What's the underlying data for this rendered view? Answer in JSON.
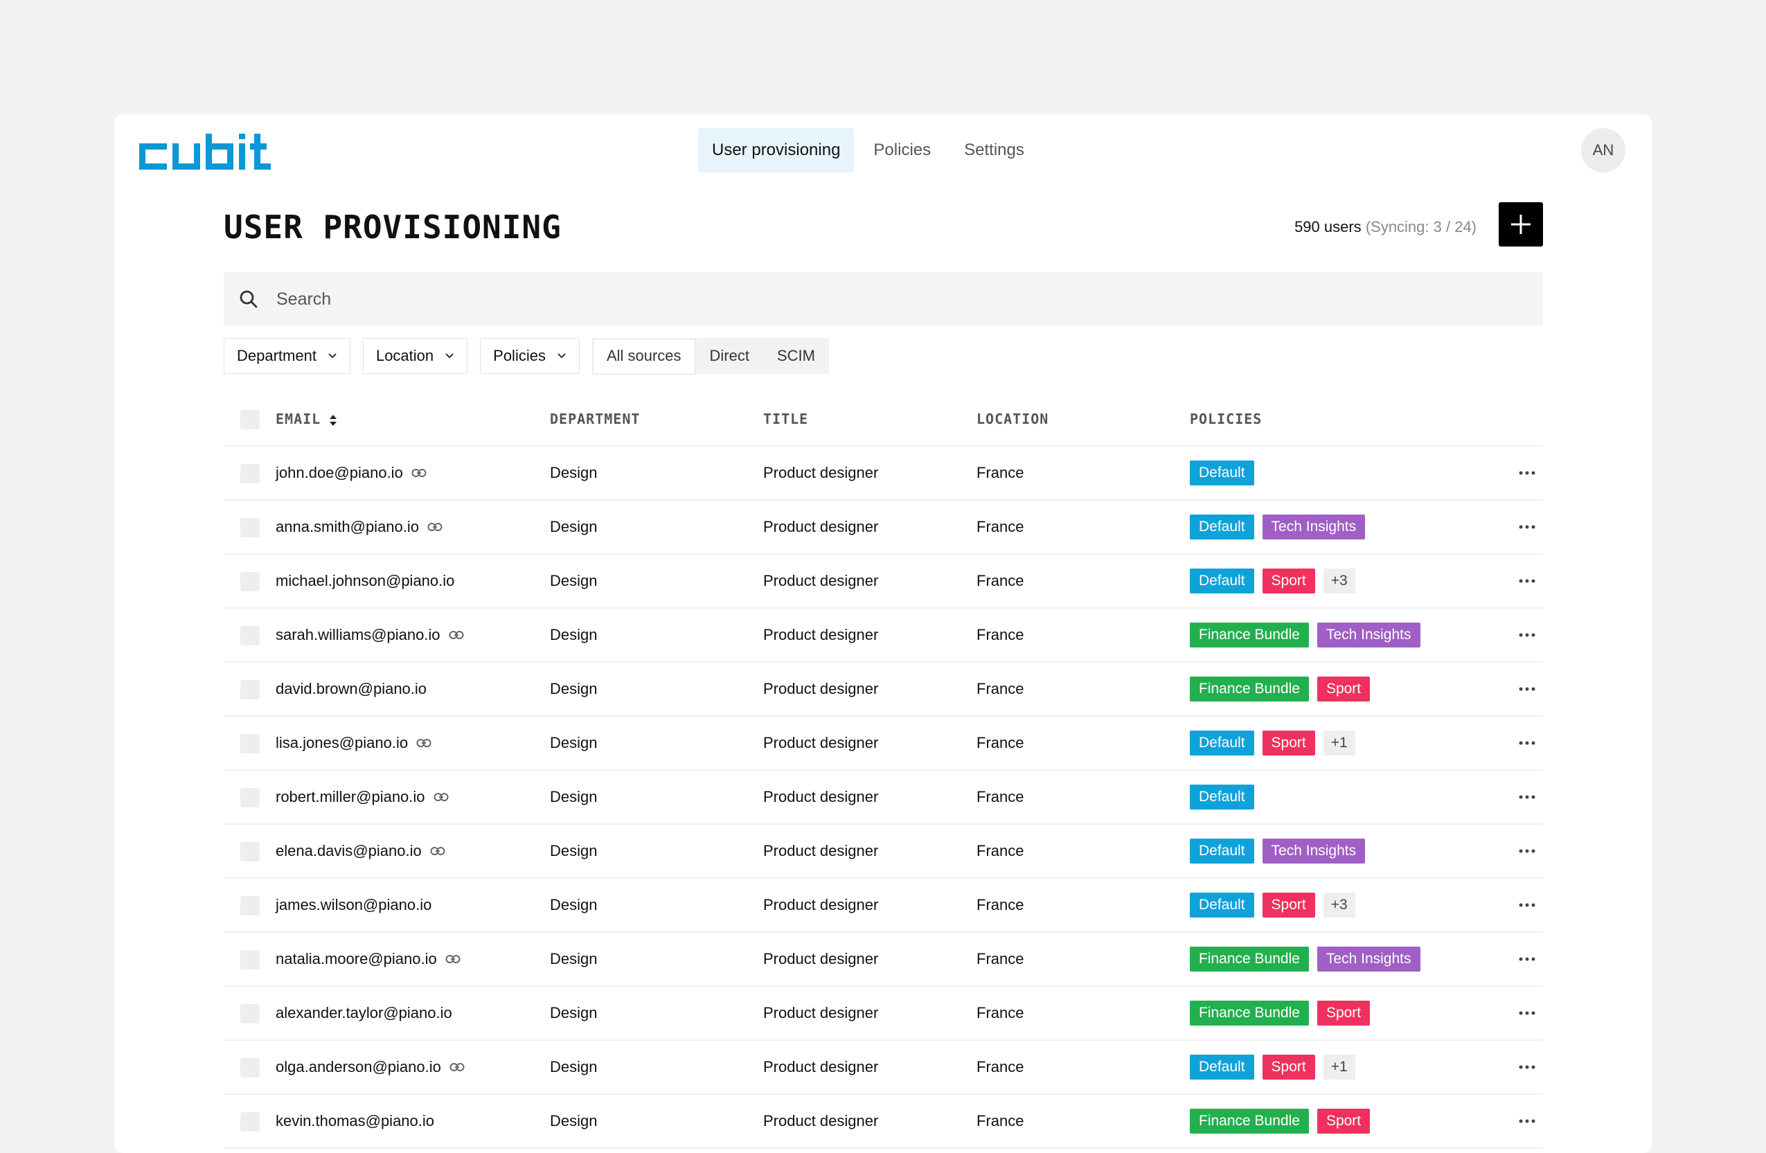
{
  "brand": {
    "logo_text": "cubit",
    "accent": "#0a98d6"
  },
  "nav": {
    "tabs": [
      {
        "label": "User provisioning",
        "active": true
      },
      {
        "label": "Policies",
        "active": false
      },
      {
        "label": "Settings",
        "active": false
      }
    ]
  },
  "user": {
    "avatar_initials": "AN"
  },
  "page": {
    "title": "USER PROVISIONING",
    "user_count": "590 users",
    "sync_status": "(Syncing: 3 / 24)",
    "add_button_icon": "plus-icon"
  },
  "search": {
    "placeholder": "Search",
    "value": ""
  },
  "filters": {
    "dropdowns": [
      {
        "label": "Department"
      },
      {
        "label": "Location"
      },
      {
        "label": "Policies"
      }
    ],
    "sources": [
      {
        "label": "All sources",
        "active": true
      },
      {
        "label": "Direct",
        "active": false
      },
      {
        "label": "SCIM",
        "active": false
      }
    ]
  },
  "table": {
    "columns": {
      "email": "EMAIL",
      "department": "DEPARTMENT",
      "title": "TITLE",
      "location": "LOCATION",
      "policies": "POLICIES"
    },
    "policy_colors": {
      "Default": "#0fa2d9",
      "Tech Insights": "#a05fc4",
      "Sport": "#f0305e",
      "Finance Bundle": "#22b04f"
    },
    "rows": [
      {
        "email": "john.doe@piano.io",
        "linked": true,
        "department": "Design",
        "title": "Product designer",
        "location": "France",
        "policies": [
          "Default"
        ],
        "more": ""
      },
      {
        "email": "anna.smith@piano.io",
        "linked": true,
        "department": "Design",
        "title": "Product designer",
        "location": "France",
        "policies": [
          "Default",
          "Tech Insights"
        ],
        "more": ""
      },
      {
        "email": "michael.johnson@piano.io",
        "linked": false,
        "department": "Design",
        "title": "Product designer",
        "location": "France",
        "policies": [
          "Default",
          "Sport"
        ],
        "more": "+3"
      },
      {
        "email": "sarah.williams@piano.io",
        "linked": true,
        "department": "Design",
        "title": "Product designer",
        "location": "France",
        "policies": [
          "Finance Bundle",
          "Tech Insights"
        ],
        "more": ""
      },
      {
        "email": "david.brown@piano.io",
        "linked": false,
        "department": "Design",
        "title": "Product designer",
        "location": "France",
        "policies": [
          "Finance Bundle",
          "Sport"
        ],
        "more": ""
      },
      {
        "email": "lisa.jones@piano.io",
        "linked": true,
        "department": "Design",
        "title": "Product designer",
        "location": "France",
        "policies": [
          "Default",
          "Sport"
        ],
        "more": "+1"
      },
      {
        "email": "robert.miller@piano.io",
        "linked": true,
        "department": "Design",
        "title": "Product designer",
        "location": "France",
        "policies": [
          "Default"
        ],
        "more": ""
      },
      {
        "email": "elena.davis@piano.io",
        "linked": true,
        "department": "Design",
        "title": "Product designer",
        "location": "France",
        "policies": [
          "Default",
          "Tech Insights"
        ],
        "more": ""
      },
      {
        "email": "james.wilson@piano.io",
        "linked": false,
        "department": "Design",
        "title": "Product designer",
        "location": "France",
        "policies": [
          "Default",
          "Sport"
        ],
        "more": "+3"
      },
      {
        "email": "natalia.moore@piano.io",
        "linked": true,
        "department": "Design",
        "title": "Product designer",
        "location": "France",
        "policies": [
          "Finance Bundle",
          "Tech Insights"
        ],
        "more": ""
      },
      {
        "email": "alexander.taylor@piano.io",
        "linked": false,
        "department": "Design",
        "title": "Product designer",
        "location": "France",
        "policies": [
          "Finance Bundle",
          "Sport"
        ],
        "more": ""
      },
      {
        "email": "olga.anderson@piano.io",
        "linked": true,
        "department": "Design",
        "title": "Product designer",
        "location": "France",
        "policies": [
          "Default",
          "Sport"
        ],
        "more": "+1"
      },
      {
        "email": "kevin.thomas@piano.io",
        "linked": false,
        "department": "Design",
        "title": "Product designer",
        "location": "France",
        "policies": [
          "Finance Bundle",
          "Sport"
        ],
        "more": ""
      }
    ]
  }
}
